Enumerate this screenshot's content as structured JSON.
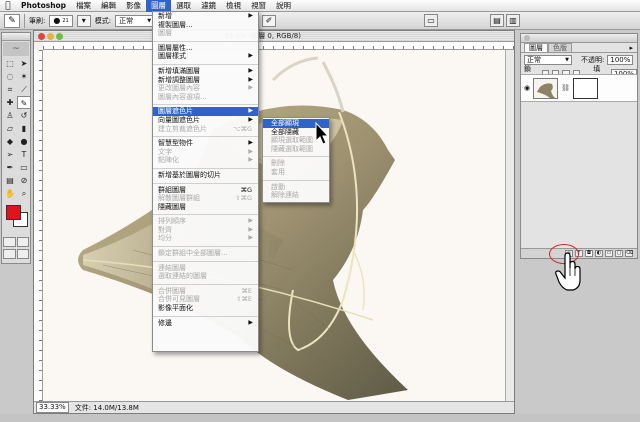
{
  "menubar": {
    "apple": "",
    "items": [
      "Photoshop",
      "檔案",
      "編輯",
      "影像",
      "圖層",
      "選取",
      "濾鏡",
      "檢視",
      "視窗",
      "說明"
    ],
    "active_index": 4
  },
  "options_bar": {
    "brush_label": "筆刷:",
    "brush_size": "21",
    "mode_label": "模式:",
    "mode_value": "正常"
  },
  "document": {
    "title": "33.3% (圖層 0, RGB/8)",
    "zoom": "33.33%",
    "file_info": "文件: 14.0M/13.8M"
  },
  "layer_menu": {
    "items": [
      {
        "label": "新增",
        "arrow": true
      },
      {
        "label": "複製圖層..."
      },
      {
        "label": "圖層",
        "disabled": true
      },
      {
        "sep": true
      },
      {
        "label": "圖層屬性..."
      },
      {
        "label": "圖層樣式",
        "arrow": true
      },
      {
        "sep": true
      },
      {
        "label": "新增填滿圖層",
        "arrow": true
      },
      {
        "label": "新增調整圖層",
        "arrow": true
      },
      {
        "label": "更改圖層內容",
        "disabled": true,
        "arrow": true
      },
      {
        "label": "圖層內容選項...",
        "disabled": true
      },
      {
        "sep": true
      },
      {
        "label": "圖層遮色片",
        "arrow": true,
        "highlight": true
      },
      {
        "label": "向量圖遮色片",
        "arrow": true
      },
      {
        "label": "建立剪裁遮色片",
        "shortcut": "⌥⌘G",
        "disabled": true
      },
      {
        "sep": true
      },
      {
        "label": "智慧型物件",
        "arrow": true
      },
      {
        "label": "文字",
        "disabled": true,
        "arrow": true
      },
      {
        "label": "點陣化",
        "disabled": true,
        "arrow": true
      },
      {
        "sep": true
      },
      {
        "label": "新增基於圖層的切片"
      },
      {
        "sep": true
      },
      {
        "label": "群組圖層",
        "shortcut": "⌘G"
      },
      {
        "label": "解散圖層群組",
        "shortcut": "⇧⌘G",
        "disabled": true
      },
      {
        "label": "隱藏圖層"
      },
      {
        "sep": true
      },
      {
        "label": "排列順序",
        "disabled": true,
        "arrow": true
      },
      {
        "label": "對齊",
        "disabled": true,
        "arrow": true
      },
      {
        "label": "均分",
        "disabled": true,
        "arrow": true
      },
      {
        "sep": true
      },
      {
        "label": "鎖定群組中全部圖層...",
        "disabled": true
      },
      {
        "sep": true
      },
      {
        "label": "連結圖層",
        "disabled": true
      },
      {
        "label": "選取連結的圖層",
        "disabled": true
      },
      {
        "sep": true
      },
      {
        "label": "合併圖層",
        "shortcut": "⌘E",
        "disabled": true
      },
      {
        "label": "合併可見圖層",
        "shortcut": "⇧⌘E",
        "disabled": true
      },
      {
        "label": "影像平面化"
      },
      {
        "sep": true
      },
      {
        "label": "修邊",
        "arrow": true
      }
    ]
  },
  "submenu": {
    "items": [
      {
        "label": "全部顯現",
        "highlight": true
      },
      {
        "label": "全部隱藏"
      },
      {
        "label": "顯現選取範圍",
        "disabled": true
      },
      {
        "label": "隱藏選取範圍",
        "disabled": true
      },
      {
        "sep": true
      },
      {
        "label": "刪除",
        "disabled": true
      },
      {
        "label": "套用",
        "disabled": true
      },
      {
        "sep": true
      },
      {
        "label": "啟動",
        "disabled": true
      },
      {
        "label": "解除連結",
        "disabled": true
      }
    ]
  },
  "layers_panel": {
    "tab_active": "圖層",
    "tab_inactive": "色版",
    "blend_mode": "正常",
    "opacity_label": "不透明:",
    "opacity_value": "100%",
    "lock_label": "鎖定:",
    "fill_label": "填滿:",
    "fill_value": "100%"
  },
  "colors": {
    "foreground": "#e0141b",
    "background": "#ffffff",
    "menu_highlight": "#2e63c9"
  }
}
